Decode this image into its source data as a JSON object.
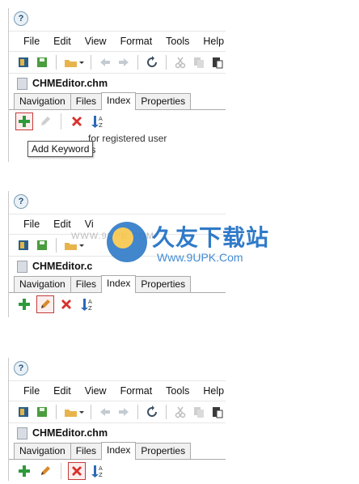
{
  "app": {
    "icon_glyph": "?",
    "file_name": "CHMEditor.chm"
  },
  "menu": [
    "File",
    "Edit",
    "View",
    "Format",
    "Tools",
    "Help"
  ],
  "menu_cut": [
    "File",
    "Edit",
    "Vi"
  ],
  "file_name_cut": "CHMEditor.c",
  "tabs": [
    "Navigation",
    "Files",
    "Index",
    "Properties"
  ],
  "active_tab": "Index",
  "panel1": {
    "tooltip": "Add Keyword",
    "tree_rows": [
      "...for registered user",
      "Features"
    ],
    "highlighted_button": "add-keyword"
  },
  "panel2": {
    "highlighted_button": "edit-keyword"
  },
  "panel3": {
    "highlighted_button": "delete-keyword"
  },
  "watermark": {
    "title": "久友下载站",
    "url": "Www.9UPK.Com",
    "faint": "WWW.9UPK.COM"
  },
  "colors": {
    "highlight": "#c23b3b",
    "add": "#2e9a3a",
    "delete": "#d9302c",
    "sort": "#2a6ab8"
  }
}
